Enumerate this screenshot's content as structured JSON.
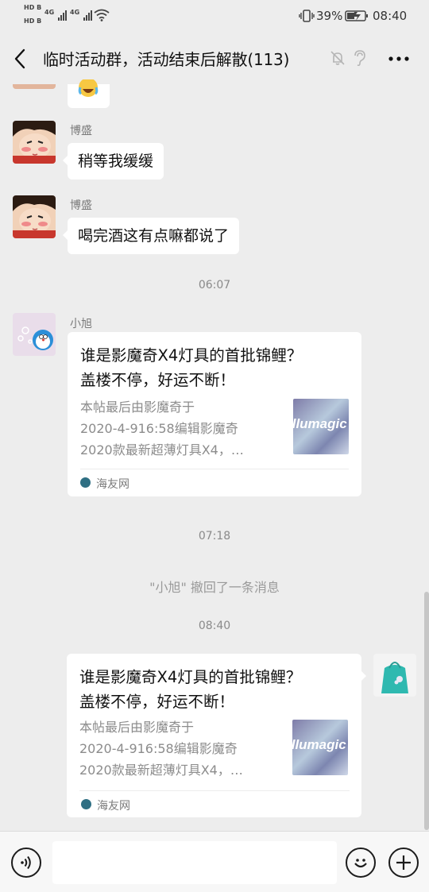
{
  "status_bar": {
    "sim1": "HD",
    "sim2": "HD",
    "network1": "4G",
    "network2": "4G",
    "battery_percent": "39%",
    "time": "08:40"
  },
  "header": {
    "title": "临时活动群，活动结束后解散(113)",
    "back_icon": "chevron-left-icon",
    "mute_icon": "bell-off-icon",
    "earpiece_icon": "ear-icon",
    "more_icon": "more-dots-icon"
  },
  "messages": [
    {
      "sender": "博盛",
      "text": "稍等我缓缓"
    },
    {
      "sender": "博盛",
      "text": "喝完酒这有点嘛都说了"
    }
  ],
  "timestamps": [
    "06:07",
    "07:18",
    "08:40"
  ],
  "shared_card": {
    "sender": "小旭",
    "title_line1": "谁是影魔奇X4灯具的首批锦鲤？",
    "title_line2": "盖楼不停，好运不断！",
    "desc_line1": "本帖最后由影魔奇于",
    "desc_line2": "2020-4-916:58编辑影魔奇",
    "desc_line3": "2020款最新超薄灯具X4，…",
    "thumb_text": "illumagic",
    "source": "海友网"
  },
  "recall_notice": "\"小旭\" 撤回了一条消息",
  "my_card": {
    "title_line1": "谁是影魔奇X4灯具的首批锦鲤？",
    "title_line2": "盖楼不停，好运不断！",
    "desc_line1": "本帖最后由影魔奇于",
    "desc_line2": "2020-4-916:58编辑影魔奇",
    "desc_line3": "2020款最新超薄灯具X4，…",
    "thumb_text": "illumagic",
    "source": "海友网"
  },
  "input_bar": {
    "voice_icon": "voice-icon",
    "emoji_icon": "emoji-icon",
    "add_icon": "plus-icon"
  }
}
